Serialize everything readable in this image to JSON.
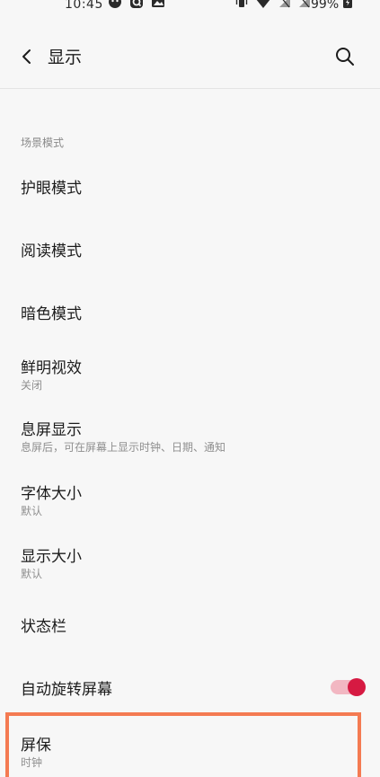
{
  "status_bar": {
    "time": "10:45",
    "battery_percent": "99%",
    "left_icons": [
      "app-icon",
      "q-icon",
      "image-icon"
    ],
    "right_icons": [
      "vibrate-icon",
      "wifi-icon",
      "no-signal-icon",
      "no-signal-icon"
    ]
  },
  "header": {
    "title": "显示",
    "back_icon": "chevron-left-icon",
    "search_icon": "search-icon"
  },
  "section": {
    "title": "场景模式"
  },
  "items": [
    {
      "title": "护眼模式",
      "subtitle": ""
    },
    {
      "title": "阅读模式",
      "subtitle": ""
    },
    {
      "title": "暗色模式",
      "subtitle": ""
    },
    {
      "title": "鲜明视效",
      "subtitle": "关闭"
    },
    {
      "title": "息屏显示",
      "subtitle": "息屏后，可在屏幕上显示时钟、日期、通知"
    },
    {
      "title": "字体大小",
      "subtitle": "默认"
    },
    {
      "title": "显示大小",
      "subtitle": "默认"
    },
    {
      "title": "状态栏",
      "subtitle": ""
    },
    {
      "title": "自动旋转屏幕",
      "subtitle": "",
      "toggle_on": true
    },
    {
      "title": "屏保",
      "subtitle": "时钟"
    }
  ],
  "colors": {
    "accent": "#d61a42",
    "toggle_track": "#f2b7c2",
    "highlight": "#f47b52",
    "background": "#f7f7f7"
  }
}
